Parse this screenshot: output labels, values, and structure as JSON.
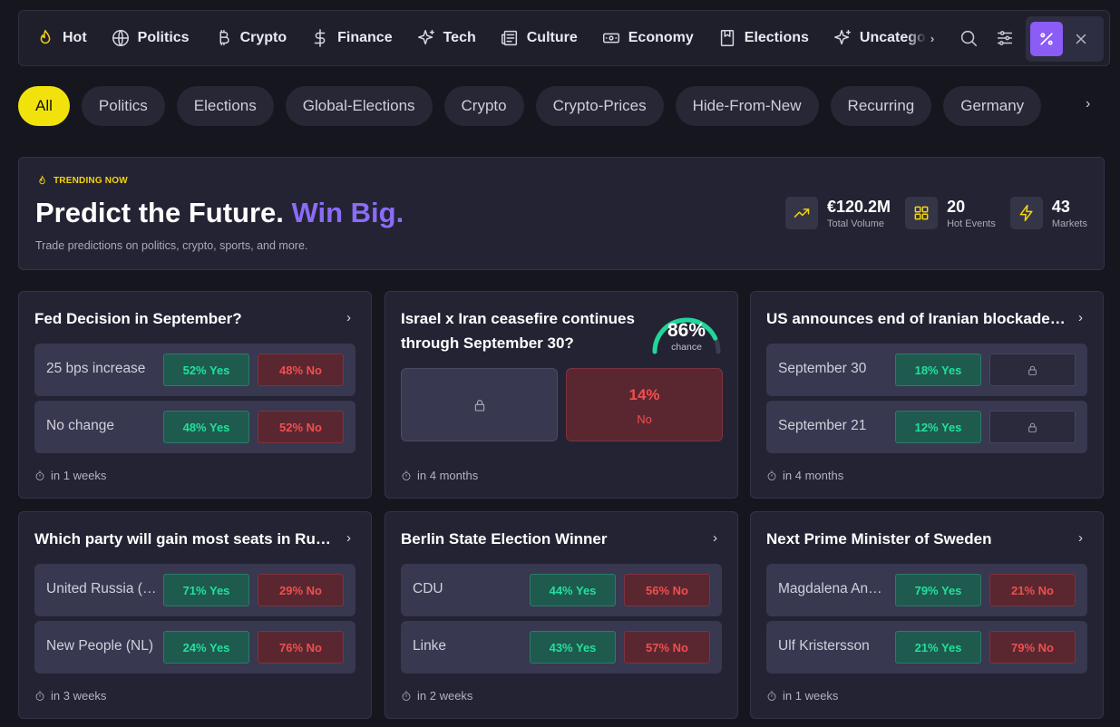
{
  "nav": {
    "items": [
      {
        "label": "Hot",
        "icon": "flame-icon"
      },
      {
        "label": "Politics",
        "icon": "globe-icon"
      },
      {
        "label": "Crypto",
        "icon": "bitcoin-icon"
      },
      {
        "label": "Finance",
        "icon": "dollar-icon"
      },
      {
        "label": "Tech",
        "icon": "sparkles-icon"
      },
      {
        "label": "Culture",
        "icon": "newspaper-icon"
      },
      {
        "label": "Economy",
        "icon": "banknote-icon"
      },
      {
        "label": "Elections",
        "icon": "ballot-icon"
      },
      {
        "label": "Uncategor",
        "icon": "sparkles-icon"
      }
    ]
  },
  "chips": [
    "All",
    "Politics",
    "Elections",
    "Global-Elections",
    "Crypto",
    "Crypto-Prices",
    "Hide-From-New",
    "Recurring",
    "Germany"
  ],
  "hero": {
    "badge": "TRENDING NOW",
    "title_main": "Predict the Future.",
    "title_accent": "Win Big.",
    "subtitle": "Trade predictions on politics, crypto, sports, and more.",
    "stats": [
      {
        "value": "€120.2M",
        "label": "Total Volume",
        "icon": "trending-up-icon"
      },
      {
        "value": "20",
        "label": "Hot Events",
        "icon": "grid-icon"
      },
      {
        "value": "43",
        "label": "Markets",
        "icon": "lightning-icon"
      }
    ]
  },
  "cards": {
    "fed": {
      "title": "Fed Decision in September?",
      "rows": [
        {
          "label": "25 bps increase",
          "yes": "52% Yes",
          "no": "48% No"
        },
        {
          "label": "No change",
          "yes": "48% Yes",
          "no": "52% No"
        }
      ],
      "footer": "in 1 weeks"
    },
    "israel": {
      "title": "Israel x Iran ceasefire continues through September 30?",
      "chance": "86%",
      "chance_value": 0.86,
      "chance_label": "chance",
      "no_pct": "14%",
      "no_label": "No",
      "footer": "in 4 months"
    },
    "us": {
      "title": "US announces end of Iranian blockade by...?",
      "rows": [
        {
          "label": "September 30",
          "yes": "18% Yes"
        },
        {
          "label": "September 21",
          "yes": "12% Yes"
        }
      ],
      "footer": "in 4 months"
    },
    "russia": {
      "title": "Which party will gain most seats in Russia?",
      "rows": [
        {
          "label": "United Russia (UR)",
          "yes": "71% Yes",
          "no": "29% No"
        },
        {
          "label": "New People (NL)",
          "yes": "24% Yes",
          "no": "76% No"
        }
      ],
      "footer": "in 3 weeks"
    },
    "berlin": {
      "title": "Berlin State Election Winner",
      "rows": [
        {
          "label": "CDU",
          "yes": "44% Yes",
          "no": "56% No"
        },
        {
          "label": "Linke",
          "yes": "43% Yes",
          "no": "57% No"
        }
      ],
      "footer": "in 2 weeks"
    },
    "sweden": {
      "title": "Next Prime Minister of Sweden",
      "rows": [
        {
          "label": "Magdalena Andersson",
          "yes": "79% Yes",
          "no": "21% No"
        },
        {
          "label": "Ulf Kristersson",
          "yes": "21% Yes",
          "no": "79% No"
        }
      ],
      "footer": "in 1 weeks"
    }
  },
  "colors": {
    "accent_purple": "#8b5cf6",
    "accent_yellow": "#f1e20c",
    "yes_green": "#21e09a",
    "no_red": "#f04f4f"
  }
}
